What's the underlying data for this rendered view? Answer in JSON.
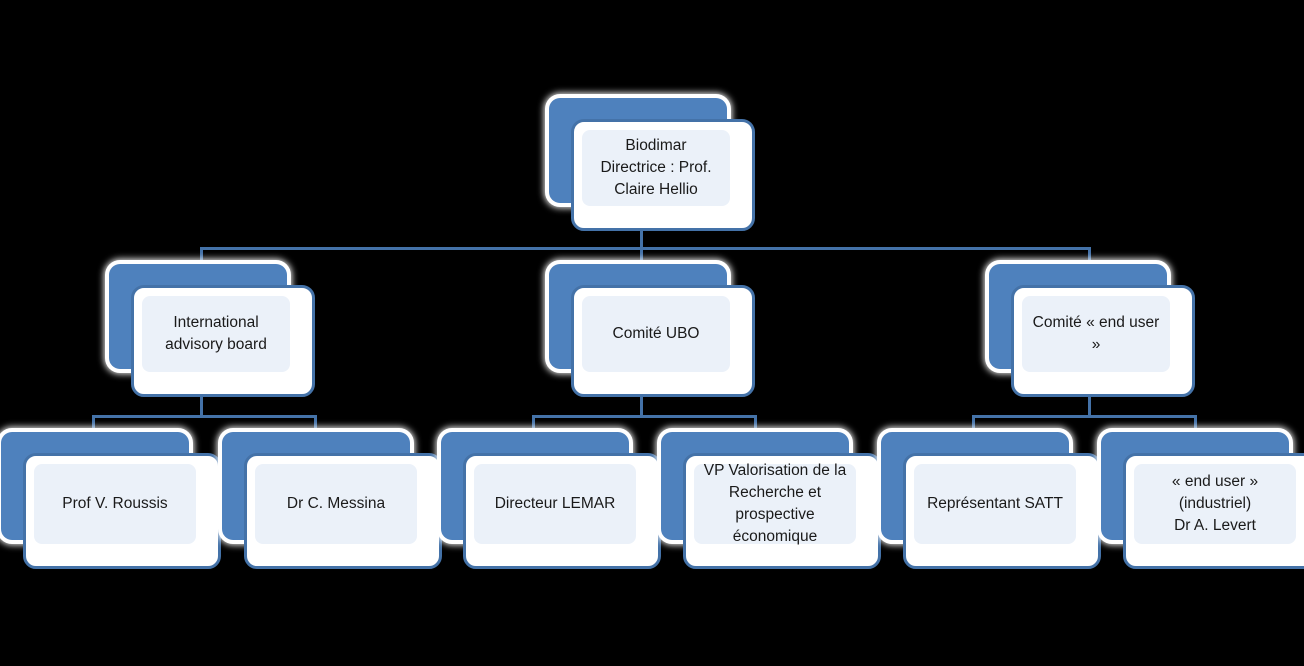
{
  "chart_data": {
    "type": "diagram",
    "subtype": "organizational-chart",
    "title": "",
    "colors": {
      "plate": "#4e81bd",
      "card_border": "#4472a8",
      "card_fill": "#ffffff",
      "panel_fill": "#ebf1f9",
      "connector": "#4472a8",
      "background": "#000000",
      "text": "#1a1a1a"
    },
    "levels": 3,
    "nodes": [
      {
        "id": "root",
        "level": 0,
        "label": "Biodimar\nDirectrice : Prof. Claire Hellio",
        "parent": null
      },
      {
        "id": "iab",
        "level": 1,
        "label": "International advisory board",
        "parent": "root"
      },
      {
        "id": "ubo",
        "level": 1,
        "label": "Comité UBO",
        "parent": "root"
      },
      {
        "id": "enduser",
        "level": 1,
        "label": "Comité « end user »",
        "parent": "root"
      },
      {
        "id": "roussis",
        "level": 2,
        "label": "Prof V. Roussis",
        "parent": "iab"
      },
      {
        "id": "messina",
        "level": 2,
        "label": "Dr C. Messina",
        "parent": "iab"
      },
      {
        "id": "lemar",
        "level": 2,
        "label": "Directeur LEMAR",
        "parent": "ubo"
      },
      {
        "id": "vp",
        "level": 2,
        "label": "VP Valorisation de la Recherche et prospective économique",
        "parent": "ubo"
      },
      {
        "id": "satt",
        "level": 2,
        "label": "Représentant SATT",
        "parent": "enduser"
      },
      {
        "id": "levert",
        "level": 2,
        "label": "« end user » (industriel)\nDr A. Levert",
        "parent": "enduser"
      }
    ]
  },
  "chart": {
    "root": {
      "label": "Biodimar\nDirectrice : Prof. Claire Hellio"
    },
    "committees": {
      "advisory_board": {
        "label": "International advisory board"
      },
      "ubo": {
        "label": "Comité UBO"
      },
      "end_user": {
        "label": "Comité « end user »"
      }
    },
    "members": {
      "roussis": {
        "label": "Prof V. Roussis"
      },
      "messina": {
        "label": "Dr C. Messina"
      },
      "lemar": {
        "label": "Directeur LEMAR"
      },
      "vp": {
        "label": "VP Valorisation de la Recherche et prospective économique"
      },
      "satt": {
        "label": "Représentant SATT"
      },
      "levert": {
        "label": "« end user » (industriel)\nDr A. Levert"
      }
    }
  }
}
